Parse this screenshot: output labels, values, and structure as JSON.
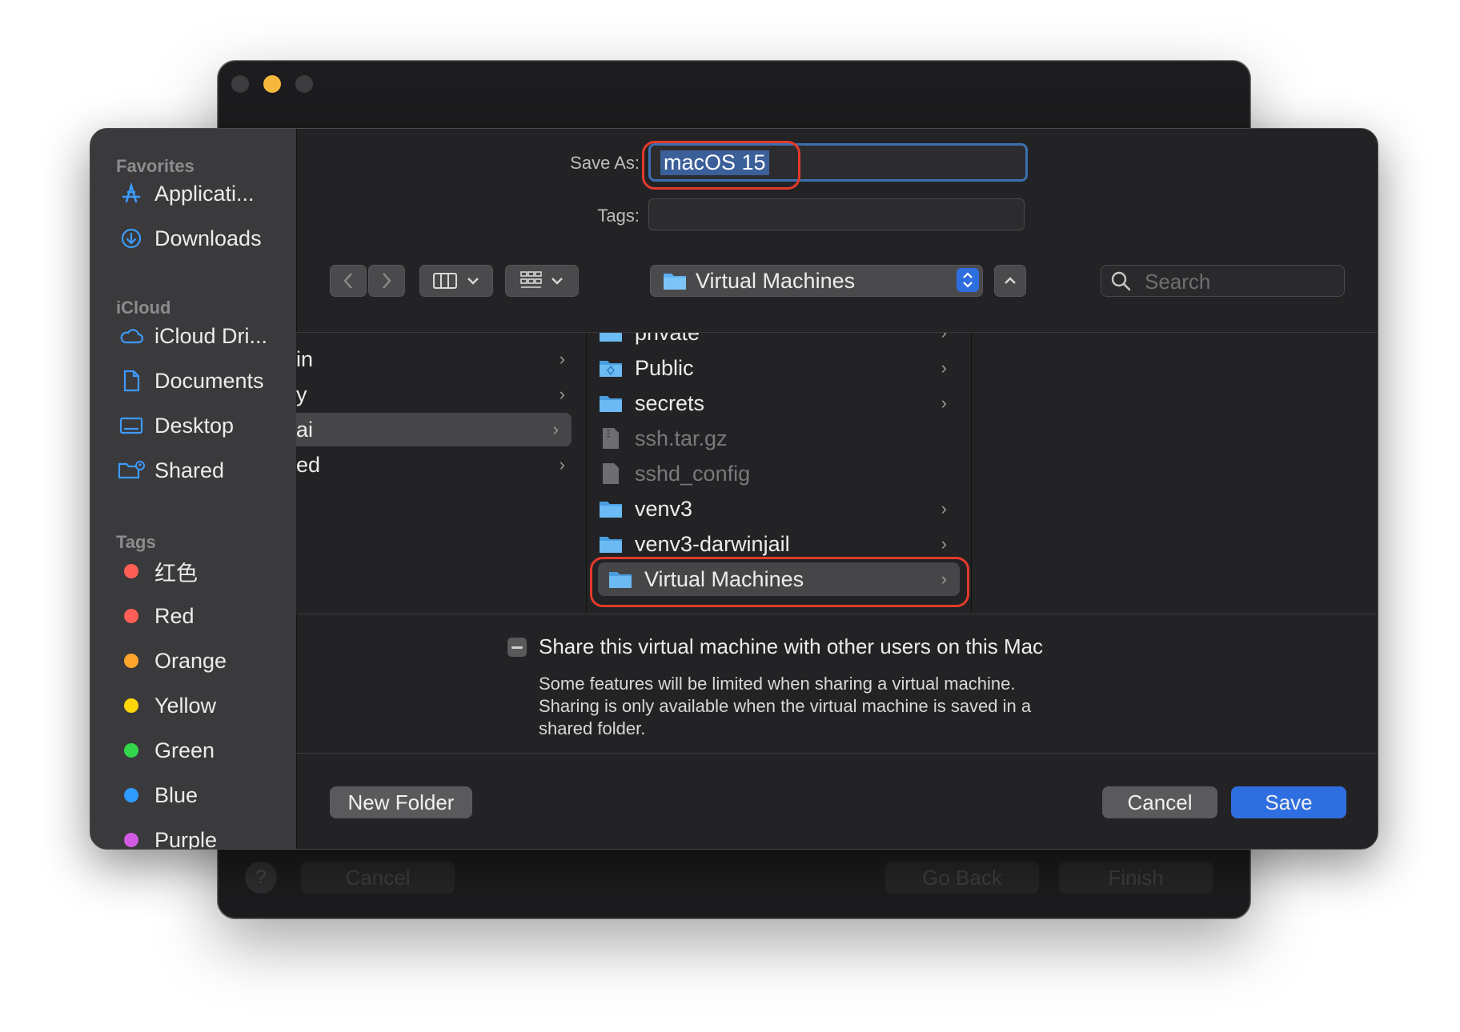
{
  "back_window": {
    "buttons": {
      "cancel": "Cancel",
      "go_back": "Go Back",
      "finish": "Finish",
      "help": "?"
    }
  },
  "sidebar": {
    "favorites_header": "Favorites",
    "favorites": [
      {
        "label": "Applicati...",
        "icon": "applications-icon"
      },
      {
        "label": "Downloads",
        "icon": "downloads-icon"
      }
    ],
    "icloud_header": "iCloud",
    "icloud": [
      {
        "label": "iCloud Dri...",
        "icon": "icloud-icon"
      },
      {
        "label": "Documents",
        "icon": "document-icon"
      },
      {
        "label": "Desktop",
        "icon": "desktop-icon"
      },
      {
        "label": "Shared",
        "icon": "shared-folder-icon"
      }
    ],
    "tags_header": "Tags",
    "tags": [
      {
        "label": "红色",
        "color": "#ff5f57"
      },
      {
        "label": "Red",
        "color": "#ff5f57"
      },
      {
        "label": "Orange",
        "color": "#ffa52c"
      },
      {
        "label": "Yellow",
        "color": "#ffd60a"
      },
      {
        "label": "Green",
        "color": "#32d74b"
      },
      {
        "label": "Blue",
        "color": "#2f9bff"
      },
      {
        "label": "Purple",
        "color": "#d05ce3"
      }
    ]
  },
  "form": {
    "save_as_label": "Save As:",
    "save_as_value": "macOS 15",
    "tags_label": "Tags:",
    "tags_value": ""
  },
  "toolbar": {
    "location": "Virtual Machines",
    "search_placeholder": "Search"
  },
  "browser": {
    "left_column": [
      {
        "name": "in",
        "chevron": "›"
      },
      {
        "name": "y",
        "chevron": "›"
      },
      {
        "name": "ai",
        "chevron": "›",
        "selected": true
      },
      {
        "name": "ed",
        "chevron": "›"
      }
    ],
    "right_column": [
      {
        "name": "private",
        "type": "folder"
      },
      {
        "name": "Public",
        "type": "public-folder"
      },
      {
        "name": "secrets",
        "type": "folder"
      },
      {
        "name": "ssh.tar.gz",
        "type": "file"
      },
      {
        "name": "sshd_config",
        "type": "file"
      },
      {
        "name": "venv3",
        "type": "folder"
      },
      {
        "name": "venv3-darwinjail",
        "type": "folder"
      },
      {
        "name": "Virtual Machines",
        "type": "folder",
        "selected": true
      }
    ]
  },
  "share": {
    "checkbox_label": "Share this virtual machine with other users on this Mac",
    "description_line1": "Some features will be limited when sharing a virtual machine.",
    "description_line2": "Sharing is only available when the virtual machine is saved in a",
    "description_line3": "shared folder."
  },
  "footer": {
    "new_folder": "New Folder",
    "cancel": "Cancel",
    "save": "Save"
  },
  "colors": {
    "accent": "#2f6ee0",
    "highlight_ring": "#e33a2b",
    "folder": "#5ab0f0"
  }
}
